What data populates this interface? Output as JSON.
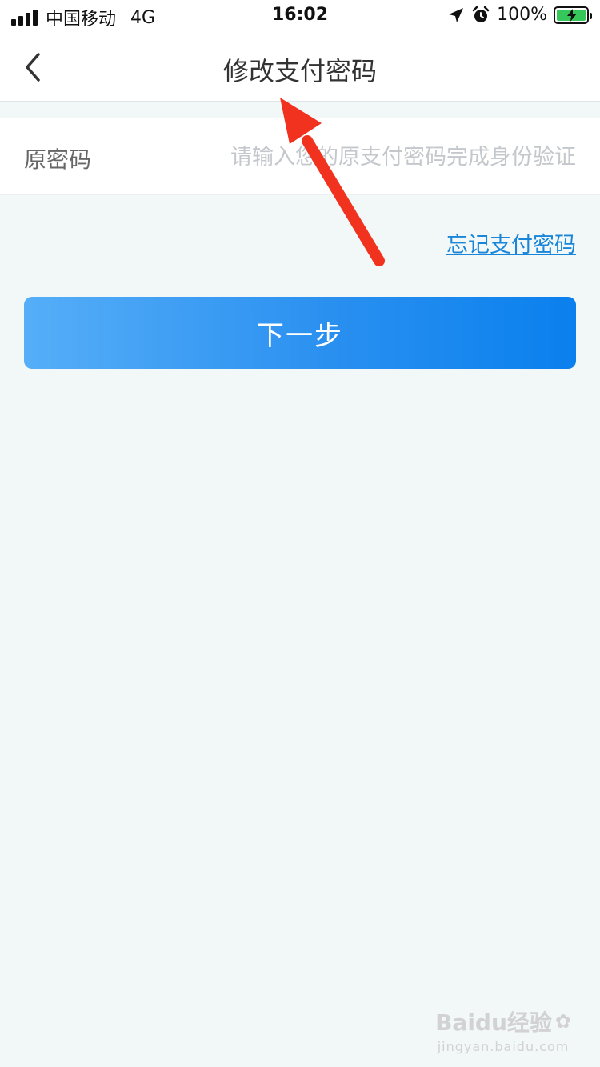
{
  "status_bar": {
    "carrier": "中国移动",
    "network": "4G",
    "time": "16:02",
    "battery": "100%",
    "battery_color": "#35c759"
  },
  "nav": {
    "title": "修改支付密码",
    "back_icon": "chevron-left-icon"
  },
  "form": {
    "label": "原密码",
    "placeholder": "请输入您的原支付密码完成身份验证",
    "value": ""
  },
  "forgot_link": "忘记支付密码",
  "next_button": "下一步",
  "colors": {
    "accent": "#1a86d9",
    "button_start": "#56aef8",
    "button_end": "#0a80ee",
    "annotation_arrow": "#f0321e",
    "background": "#f2f7f7"
  },
  "watermark": {
    "main": "Baidu经验",
    "sub": "jingyan.baidu.com"
  }
}
